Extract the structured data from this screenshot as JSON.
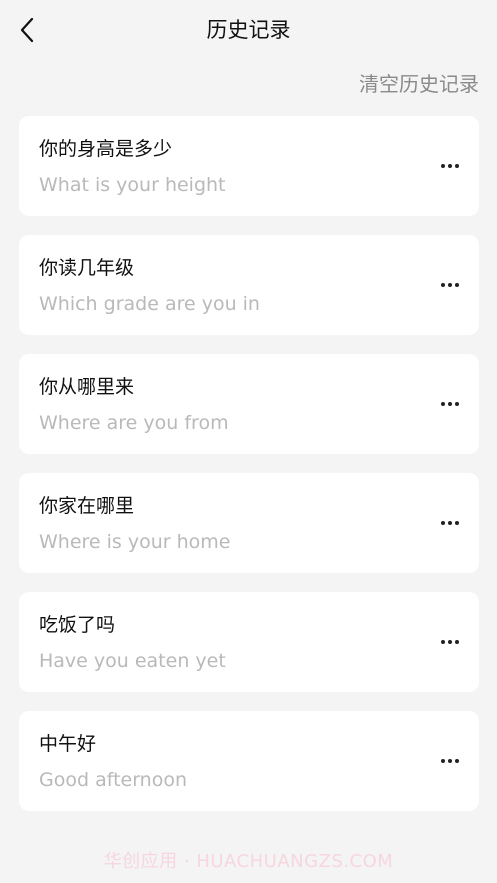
{
  "header": {
    "title": "历史记录",
    "back_icon": "chevron-left-icon"
  },
  "toolbar": {
    "clear_label": "清空历史记录"
  },
  "history": [
    {
      "cn": "你的身高是多少",
      "en": "What is your height"
    },
    {
      "cn": "你读几年级",
      "en": "Which grade are you in"
    },
    {
      "cn": "你从哪里来",
      "en": "Where are you from"
    },
    {
      "cn": "你家在哪里",
      "en": "Where is your home"
    },
    {
      "cn": "吃饭了吗",
      "en": "Have you eaten yet"
    },
    {
      "cn": "中午好",
      "en": "Good afternoon"
    }
  ],
  "more_icon": "more-horizontal-icon",
  "watermark": "华创应用 · HUACHUANGZS.COM",
  "colors": {
    "background": "#f4f4f4",
    "card": "#ffffff",
    "primary_text": "#111111",
    "secondary_text": "#b9b9b9",
    "link_text": "#8a8a8a"
  }
}
